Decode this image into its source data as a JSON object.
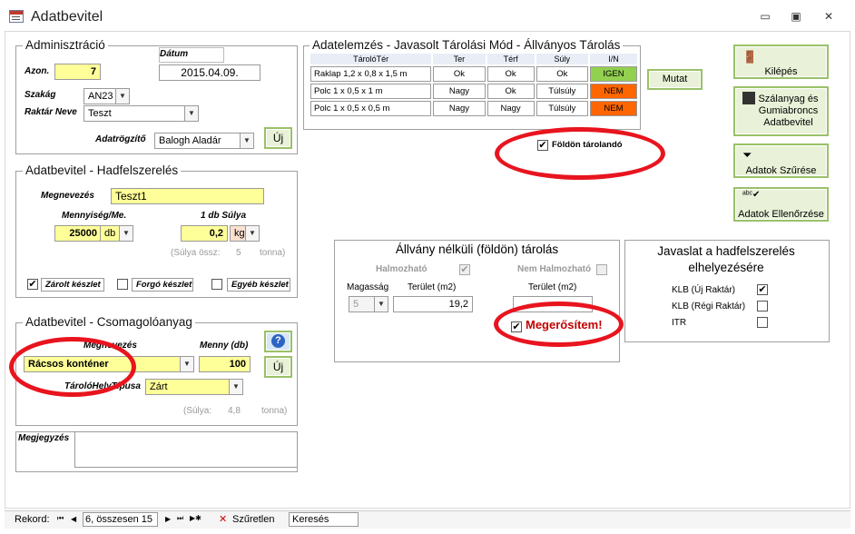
{
  "window": {
    "title": "Adatbevitel",
    "controls": {
      "minimize": "▭",
      "maximize": "▣",
      "close": "✕"
    }
  },
  "admin": {
    "title": "Adminisztráció",
    "datum_label": "Dátum",
    "datum_value": "2015.04.09.",
    "azon_label": "Azon.",
    "azon_value": "7",
    "szakag_label": "Szakág",
    "szakag_value": "AN23",
    "raktar_label": "Raktár Neve",
    "raktar_value": "Teszt",
    "adatrogzito_label": "Adatrögzítő",
    "adatrogzito_value": "Balogh Aladár",
    "uj_label": "Új"
  },
  "analysis": {
    "title": "Adatelemzés - Javasolt Tárolási Mód  - Állványos Tárolás",
    "headers": [
      "TárolóTér",
      "Ter",
      "Térf",
      "Súly",
      "I/N"
    ],
    "rows": [
      [
        "Raklap 1,2 x 0,8 x 1,5 m",
        "Ok",
        "Ok",
        "Ok",
        "IGEN"
      ],
      [
        "Polc 1 x 0,5 x 1 m",
        "Nagy",
        "Ok",
        "Túlsúly",
        "NEM"
      ],
      [
        "Polc 1 x 0,5 x 0,5 m",
        "Nagy",
        "Nagy",
        "Túlsúly",
        "NEM"
      ]
    ],
    "mutat_label": "Mutat",
    "foldon_label": "Földön tárolandó",
    "foldon_checked": "✔"
  },
  "hadfelszereles": {
    "title": "Adatbevitel - Hadfelszerelés",
    "megnevezes_label": "Megnevezés",
    "megnevezes_value": "Teszt1",
    "mennyiseg_label": "Mennyiség/Me.",
    "mennyiseg_value": "25000",
    "mennyiseg_unit": "db",
    "suly_label": "1 db Súlya",
    "suly_value": "0,2",
    "suly_unit": "kg",
    "suly_ossz_label": "(Súlya össz:",
    "suly_ossz_value": "5",
    "suly_ossz_unit": "tonna)",
    "zarolt_label": "Zárolt készlet",
    "zarolt_checked": "✔",
    "forgo_label": "Forgó készlet",
    "egyeb_label": "Egyéb készlet"
  },
  "csomagolo": {
    "title": "Adatbevitel - Csomagolóanyag",
    "megnevezes_label": "Megnevezés",
    "megnevezes_value": "Rácsos konténer",
    "menny_label": "Menny (db)",
    "menny_value": "100",
    "tarolohely_label": "TárolóHelyTípusa",
    "tarolohely_value": "Zárt",
    "suly_label": "(Súlya:",
    "suly_value": "4,8",
    "suly_unit": "tonna)",
    "uj_label": "Új",
    "help_icon": "?"
  },
  "megjegyzes": {
    "label": "Megjegyzés",
    "value": ""
  },
  "floor": {
    "title": "Állvány nélküli (földön) tárolás",
    "halmozhato_label": "Halmozható",
    "nem_halmozhato_label": "Nem Halmozható",
    "magassag_label": "Magasság",
    "magassag_value": "5",
    "terulet1_label": "Terület (m2)",
    "terulet1_value": "19,2",
    "terulet2_label": "Terület (m2)",
    "terulet2_value": "",
    "megerositem_label": "Megerősítem!",
    "check_mark": "✔"
  },
  "javaslat": {
    "title": "Javaslat a hadfelszerelés elhelyezésére",
    "items": [
      {
        "label": "KLB (Új Raktár)",
        "checked": "✔"
      },
      {
        "label": "KLB (Régi Raktár)",
        "checked": ""
      },
      {
        "label": "ITR",
        "checked": ""
      }
    ]
  },
  "buttons": {
    "kilepes": "Kilépés",
    "szalanyag": "Szálanyag és Gumiabroncs Adatbevitel",
    "szures": "Adatok Szűrése",
    "ellenorzes": "Adatok Ellenőrzése"
  },
  "statusbar": {
    "rekord_label": "Rekord:",
    "rekord_value": "6, összesen 15",
    "szuretlen": "Szűretlen",
    "kereses": "Keresés",
    "nav_first": "⏮",
    "nav_prev": "◀",
    "nav_next": "▶",
    "nav_last": "⏭",
    "nav_new": "▶✱"
  },
  "colors": {
    "highlight_circle": "#e8141e",
    "field_yellow": "#ffff99",
    "igen": "#92d050",
    "nem": "#ff6600",
    "button_border": "#9ac168"
  }
}
